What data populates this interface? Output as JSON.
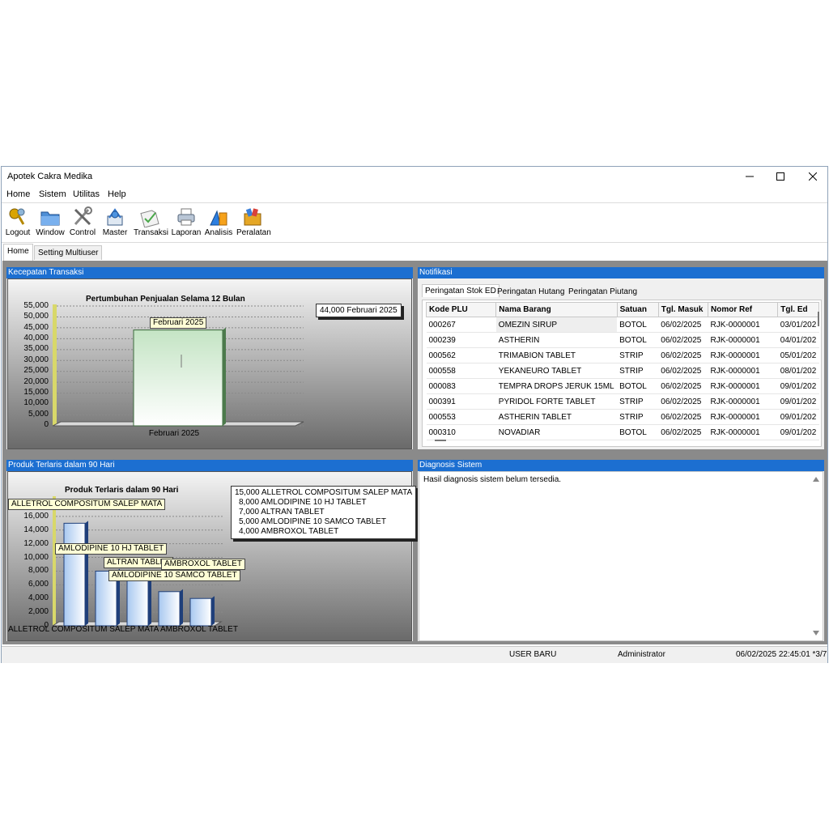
{
  "window": {
    "title": "Apotek Cakra Medika"
  },
  "menu": {
    "items": [
      "Home",
      "Sistem",
      "Utilitas",
      "Help"
    ]
  },
  "toolbar": {
    "items": [
      {
        "label": "Logout",
        "icon": "keys-icon"
      },
      {
        "label": "Window",
        "icon": "folder-icon"
      },
      {
        "label": "Control",
        "icon": "tools-icon"
      },
      {
        "label": "Master",
        "icon": "master-icon"
      },
      {
        "label": "Transaksi",
        "icon": "check-document-icon"
      },
      {
        "label": "Laporan",
        "icon": "printer-icon"
      },
      {
        "label": "Analisis",
        "icon": "analysis-shapes-icon"
      },
      {
        "label": "Peralatan",
        "icon": "toolbox-icon"
      }
    ]
  },
  "tabs": [
    {
      "label": "Home",
      "active": true
    },
    {
      "label": "Setting Multiuser",
      "active": false
    }
  ],
  "panels": {
    "kecepatan": {
      "header": "Kecepatan Transaksi"
    },
    "notifikasi": {
      "header": "Notifikasi",
      "subtabs": [
        "Peringatan Stok ED",
        "Peringatan Hutang",
        "Peringatan Piutang"
      ],
      "columns": [
        "Kode PLU",
        "Nama Barang",
        "Satuan",
        "Tgl. Masuk",
        "Nomor Ref",
        "Tgl. Ed"
      ],
      "rows": [
        [
          "000267",
          "OMEZIN SIRUP",
          "BOTOL",
          "06/02/2025",
          "RJK-0000001",
          "03/01/202"
        ],
        [
          "000239",
          "ASTHERIN",
          "BOTOL",
          "06/02/2025",
          "RJK-0000001",
          "04/01/202"
        ],
        [
          "000562",
          "TRIMABION TABLET",
          "STRIP",
          "06/02/2025",
          "RJK-0000001",
          "05/01/202"
        ],
        [
          "000558",
          "YEKANEURO TABLET",
          "STRIP",
          "06/02/2025",
          "RJK-0000001",
          "08/01/202"
        ],
        [
          "000083",
          "TEMPRA DROPS JERUK 15ML",
          "BOTOL",
          "06/02/2025",
          "RJK-0000001",
          "09/01/202"
        ],
        [
          "000391",
          "PYRIDOL FORTE TABLET",
          "STRIP",
          "06/02/2025",
          "RJK-0000001",
          "09/01/202"
        ],
        [
          "000553",
          "ASTHERIN TABLET",
          "STRIP",
          "06/02/2025",
          "RJK-0000001",
          "09/01/202"
        ],
        [
          "000310",
          "NOVADIAR",
          "BOTOL",
          "06/02/2025",
          "RJK-0000001",
          "09/01/202"
        ]
      ]
    },
    "terlaris": {
      "header": "Produk Terlaris dalam 90 Hari"
    },
    "diagnosis": {
      "header": "Diagnosis Sistem",
      "text": "Hasil diagnosis sistem belum tersedia."
    }
  },
  "chart_data": [
    {
      "type": "bar",
      "title": "Pertumbuhan Penjualan Selama 12 Bulan",
      "categories": [
        "Februari 2025"
      ],
      "values": [
        44000
      ],
      "ylim": [
        0,
        55000
      ],
      "yticks": [
        "55,000",
        "50,000",
        "45,000",
        "40,000",
        "35,000",
        "30,000",
        "25,000",
        "20,000",
        "15,000",
        "10,000",
        "5,000",
        "0"
      ],
      "bar_labels": [
        "Februari 2025"
      ],
      "annotation": "44,000 Februari 2025",
      "grid": true
    },
    {
      "type": "bar",
      "title": "Produk Terlaris dalam 90 Hari",
      "categories": [
        "ALLETROL COMPOSITUM SALEP MATA",
        "AMLODIPINE 10 HJ TABLET",
        "ALTRAN TABLET",
        "AMLODIPINE 10 SAMCO TABLET",
        "AMBROXOL TABLET"
      ],
      "values": [
        15000,
        8000,
        7000,
        5000,
        4000
      ],
      "ylim": [
        0,
        18000
      ],
      "yticks": [
        "16,000",
        "14,000",
        "12,000",
        "10,000",
        "8,000",
        "6,000",
        "4,000",
        "2,000",
        "0"
      ],
      "xtick_labels": [
        "ALLETROL COMPOSITUM SALEP MATA",
        "AMBROXOL TABLET"
      ],
      "bar_labels": [
        "ALLETROL COMPOSITUM SALEP MATA",
        "AMLODIPINE 10 HJ TABLET",
        "ALTRAN TABLET",
        "AMLODIPINE 10 SAMCO TABLET",
        "AMBROXOL TABLET"
      ],
      "legend": [
        "15,000 ALLETROL COMPOSITUM SALEP MATA",
        "8,000 AMLODIPINE 10 HJ TABLET",
        "7,000 ALTRAN TABLET",
        "5,000 AMLODIPINE 10 SAMCO TABLET",
        "4,000 AMBROXOL TABLET"
      ],
      "grid": true
    }
  ],
  "status": {
    "user": "USER BARU",
    "role": "Administrator",
    "datetime": "06/02/2025  22:45:01 *3/7"
  }
}
